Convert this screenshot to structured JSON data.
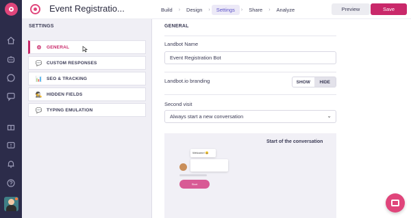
{
  "header": {
    "bot_title": "Event Registratio...",
    "steps": [
      "Build",
      "Design",
      "Settings",
      "Share",
      "Analyze"
    ],
    "active_step": "Settings",
    "preview_label": "Preview",
    "save_label": "Save"
  },
  "sidebar": {
    "heading": "SETTINGS",
    "items": [
      {
        "label": "GENERAL",
        "icon": "gear-icon",
        "active": true
      },
      {
        "label": "CUSTOM RESPONSES",
        "icon": "speech-bubble-icon",
        "active": false
      },
      {
        "label": "SEO & TRACKING",
        "icon": "chart-icon",
        "active": false
      },
      {
        "label": "HIDDEN FIELDS",
        "icon": "detective-icon",
        "active": false
      },
      {
        "label": "TYPING EMULATION",
        "icon": "speech-bubble-icon",
        "active": false
      }
    ]
  },
  "main": {
    "heading": "GENERAL",
    "landbot_name_label": "Landbot Name",
    "landbot_name_value": "Event Registration Bot",
    "branding_label": "Landbot.io branding",
    "branding_show": "SHOW",
    "branding_hide": "HIDE",
    "branding_selected": "HIDE",
    "second_visit_label": "Second visit",
    "second_visit_value": "Always start a new conversation",
    "preview": {
      "title": "Start of the conversation",
      "welcome_text": "Welcome! 😀",
      "button_text": "Start"
    }
  },
  "colors": {
    "brand": "#e0457b",
    "save": "#c9286a",
    "rail": "#2c2c4a",
    "active_step": "#5b52c8"
  }
}
